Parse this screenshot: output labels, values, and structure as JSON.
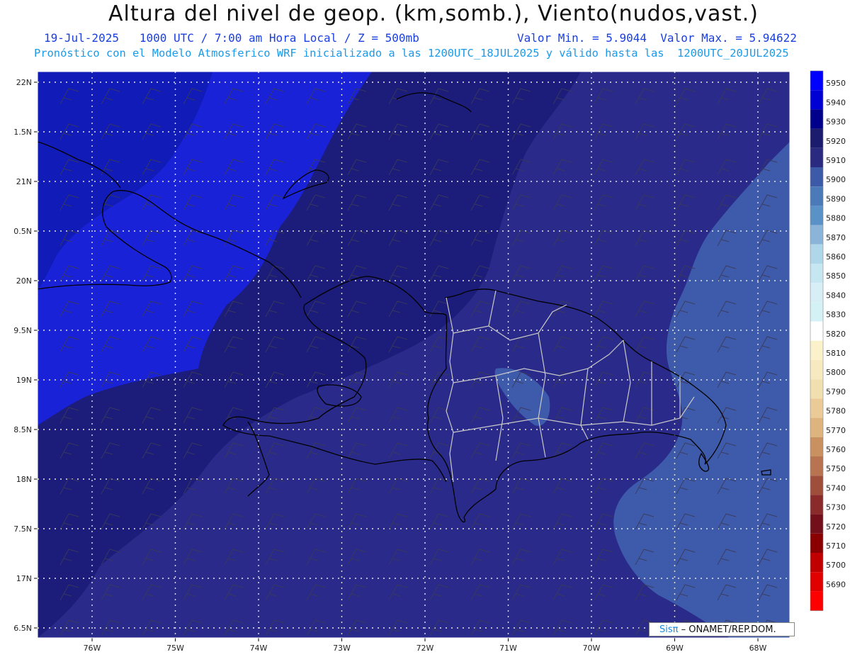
{
  "header": {
    "title": "Altura del nivel de geop. (km,somb.), Viento(nudos,vast.)",
    "date": "19-Jul-2025",
    "time": "1000 UTC / 7:00 am Hora Local / Z = 500mb",
    "minmax": "Valor Min. = 5.9044  Valor Max. = 5.94622",
    "model": "Pronóstico con el Modelo Atmosferico WRF inicializado a las 1200UTC_18JUL2025 y válido hasta las  1200UTC_20JUL2025"
  },
  "map": {
    "lat_labels": [
      "22N",
      "1.5N",
      "21N",
      "0.5N",
      "20N",
      "9.5N",
      "19N",
      "8.5N",
      "18N",
      "7.5N",
      "17N",
      "6.5N"
    ],
    "lon_labels": [
      "76W",
      "75W",
      "74W",
      "73W",
      "72W",
      "71W",
      "70W",
      "69W",
      "68W"
    ],
    "colors": {
      "z5940": "#1a22d8",
      "z5930": "#1c1c7a",
      "z5920": "#2a2a8a",
      "z5910": "#3e5bab",
      "coast": "#000000",
      "provinces": "#c8c8c8",
      "grid": "#e6e6e6"
    }
  },
  "legend": {
    "labels": [
      "5950",
      "5940",
      "5930",
      "5920",
      "5910",
      "5900",
      "5890",
      "5880",
      "5870",
      "5860",
      "5850",
      "5840",
      "5830",
      "5820",
      "5810",
      "5800",
      "5790",
      "5780",
      "5770",
      "5760",
      "5750",
      "5740",
      "5730",
      "5720",
      "5710",
      "5700",
      "5690"
    ],
    "colors": [
      "#0000ff",
      "#0000d4",
      "#00008a",
      "#1c1c6e",
      "#2a2a80",
      "#3c5aa8",
      "#4a7ab8",
      "#5a92c8",
      "#8ab4d8",
      "#b0d6ea",
      "#c6e6f2",
      "#d8eef7",
      "#d4f2f6",
      "#ffffff",
      "#fbf2cc",
      "#f7e9c0",
      "#f2dfb0",
      "#eacb98",
      "#ddb47e",
      "#c99060",
      "#b87450",
      "#a04e3c",
      "#8a2a2a",
      "#720f1a",
      "#8a0000",
      "#c00000",
      "#e00000",
      "#ff0000"
    ]
  },
  "footer": {
    "sis": "Sisπ",
    "org": "– ONAMET/REP.DOM."
  }
}
